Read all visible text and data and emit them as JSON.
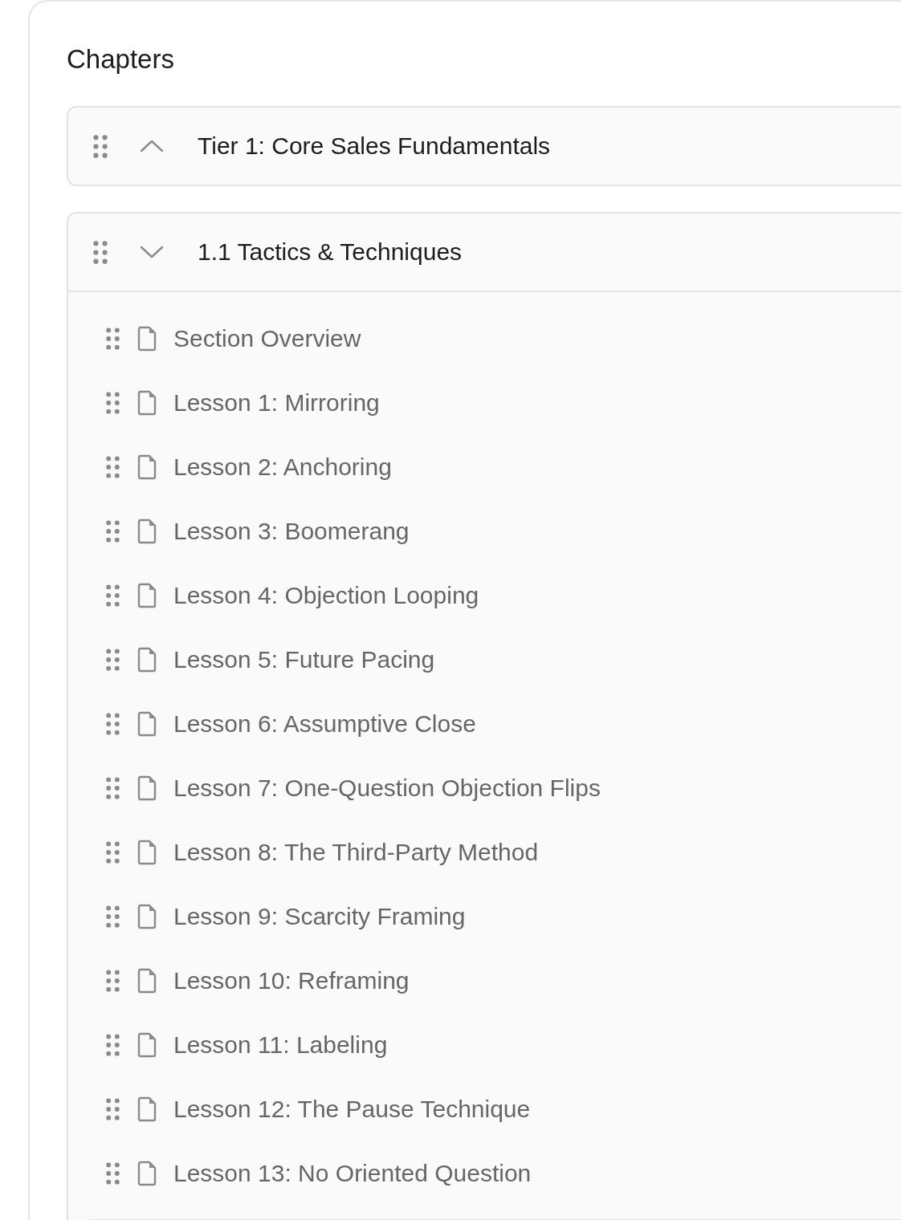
{
  "title": "Chapters",
  "chapters": [
    {
      "title": "Tier 1: Core Sales Fundamentals",
      "expanded": false
    },
    {
      "title": "1.1 Tactics & Techniques",
      "expanded": true,
      "lessons": [
        {
          "title": "Section Overview"
        },
        {
          "title": "Lesson 1: Mirroring"
        },
        {
          "title": "Lesson 2: Anchoring"
        },
        {
          "title": "Lesson 3: Boomerang"
        },
        {
          "title": "Lesson 4: Objection Looping"
        },
        {
          "title": "Lesson 5: Future Pacing"
        },
        {
          "title": "Lesson 6: Assumptive Close"
        },
        {
          "title": "Lesson 7: One-Question Objection Flips"
        },
        {
          "title": "Lesson 8: The Third-Party Method"
        },
        {
          "title": "Lesson 9: Scarcity Framing"
        },
        {
          "title": "Lesson 10: Reframing"
        },
        {
          "title": "Lesson 11: Labeling"
        },
        {
          "title": "Lesson 12: The Pause Technique"
        },
        {
          "title": "Lesson 13: No Oriented Question"
        }
      ]
    }
  ]
}
